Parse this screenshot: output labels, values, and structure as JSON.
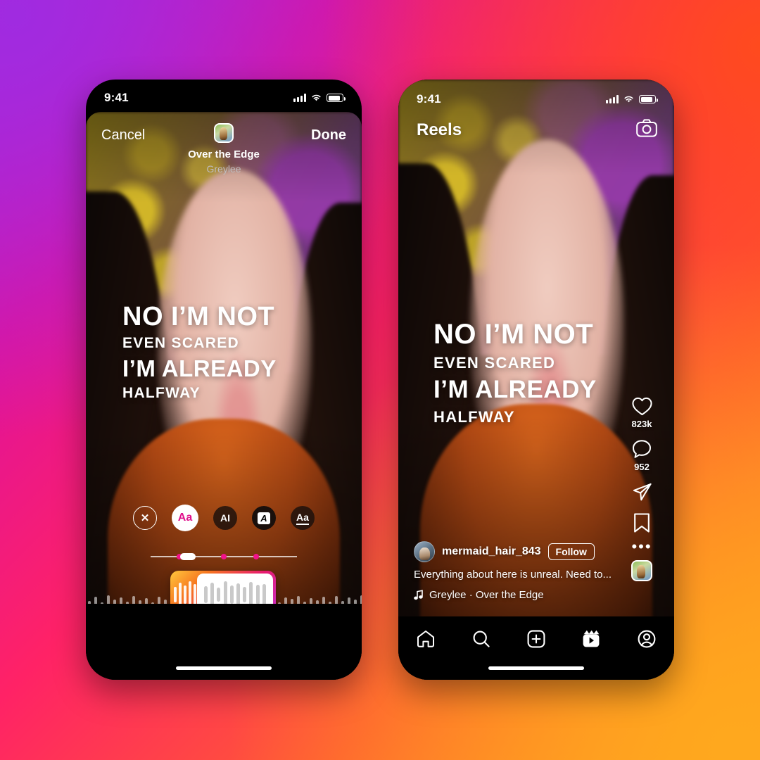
{
  "background": {
    "gradient_colors": [
      "#B322D8",
      "#E0129B",
      "#FF2266",
      "#FF5A33",
      "#FFA41C"
    ]
  },
  "lyrics": {
    "line1": "NO I’M NOT",
    "line2": "EVEN SCARED",
    "line3": "I’M ALREADY",
    "line4": "HALFWAY"
  },
  "left_phone": {
    "status_bar": {
      "time": "9:41",
      "signal_icon": "cellular-bars-icon",
      "wifi_icon": "wifi-icon",
      "battery_icon": "battery-icon"
    },
    "header": {
      "cancel_label": "Cancel",
      "done_label": "Done",
      "album_art_icon": "album-art-thumbnail",
      "track_title": "Over the Edge",
      "track_artist": "Greylee"
    },
    "style_chips": [
      {
        "name": "close-style-icon",
        "glyph": "✕",
        "selected": false
      },
      {
        "name": "style-aa-pink",
        "glyph": "Aa",
        "selected": true
      },
      {
        "name": "style-typewriter",
        "glyph": "AI",
        "selected": false
      },
      {
        "name": "style-boxed-a",
        "glyph": "A",
        "selected": false
      },
      {
        "name": "style-underline-aa",
        "glyph": "Aa",
        "selected": false
      }
    ],
    "timeline": {
      "knob_position_pct": 22,
      "dot_positions_pct": [
        22,
        48,
        70
      ]
    },
    "trimmer": {
      "label": "audio-waveform-trimmer"
    }
  },
  "right_phone": {
    "status_bar": {
      "time": "9:41",
      "signal_icon": "cellular-bars-icon",
      "wifi_icon": "wifi-icon",
      "battery_icon": "battery-icon"
    },
    "header": {
      "title": "Reels",
      "camera_icon": "camera-icon"
    },
    "actions": {
      "like": {
        "icon": "heart-icon",
        "count": "823k"
      },
      "comment": {
        "icon": "comment-bubble-icon",
        "count": "952"
      },
      "share": {
        "icon": "paper-plane-icon",
        "count": ""
      },
      "save": {
        "icon": "bookmark-icon",
        "count": ""
      },
      "more": {
        "icon": "more-dots-icon",
        "glyph": "•••"
      },
      "audio_art": {
        "icon": "album-art-thumbnail"
      }
    },
    "caption": {
      "avatar_icon": "user-avatar",
      "username": "mermaid_hair_843",
      "follow_label": "Follow",
      "text": "Everything about here is unreal. Need to...",
      "music_icon": "music-note-icon",
      "music_text": "Greylee · Over the Edge"
    },
    "nav": [
      {
        "name": "nav-home",
        "icon": "home-icon"
      },
      {
        "name": "nav-search",
        "icon": "search-icon"
      },
      {
        "name": "nav-create",
        "icon": "plus-square-icon"
      },
      {
        "name": "nav-reels",
        "icon": "reels-clapper-icon"
      },
      {
        "name": "nav-profile",
        "icon": "profile-circle-icon"
      }
    ]
  }
}
